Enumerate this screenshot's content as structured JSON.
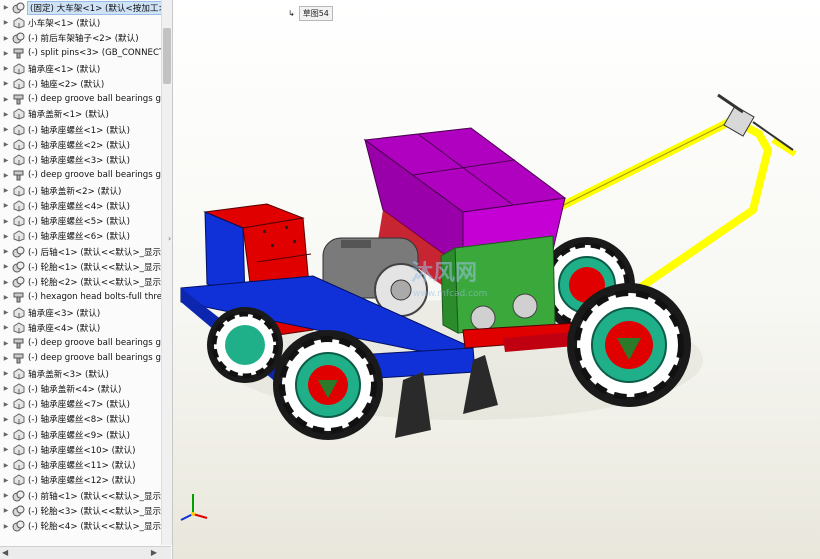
{
  "tree_items": [
    {
      "label": "(固定) 大车架<1> (默认<按加工>",
      "icon": "assembly-icon",
      "selected": true
    },
    {
      "label": "小车架<1> (默认)",
      "icon": "part-icon"
    },
    {
      "label": "(-) 前后车架轴子<2> (默认)",
      "icon": "assembly-icon"
    },
    {
      "label": "(-) split pins<3> (GB_CONNECT",
      "icon": "toolbox-part-icon"
    },
    {
      "label": "轴承座<1> (默认)",
      "icon": "part-icon"
    },
    {
      "label": "(-) 轴座<2> (默认)",
      "icon": "part-icon"
    },
    {
      "label": "(-) deep groove ball bearings g",
      "icon": "toolbox-part-icon"
    },
    {
      "label": "轴承盖新<1> (默认)",
      "icon": "part-icon"
    },
    {
      "label": "(-) 轴承座螺丝<1> (默认)",
      "icon": "part-icon"
    },
    {
      "label": "(-) 轴承座螺丝<2> (默认)",
      "icon": "part-icon"
    },
    {
      "label": "(-) 轴承座螺丝<3> (默认)",
      "icon": "part-icon"
    },
    {
      "label": "(-) deep groove ball bearings g",
      "icon": "toolbox-part-icon"
    },
    {
      "label": "(-) 轴承盖新<2> (默认)",
      "icon": "part-icon"
    },
    {
      "label": "(-) 轴承座螺丝<4> (默认)",
      "icon": "part-icon"
    },
    {
      "label": "(-) 轴承座螺丝<5> (默认)",
      "icon": "part-icon"
    },
    {
      "label": "(-) 轴承座螺丝<6> (默认)",
      "icon": "part-icon"
    },
    {
      "label": "(-) 后轴<1> (默认<<默认>_显示状",
      "icon": "assembly-icon"
    },
    {
      "label": "(-) 轮胎<1> (默认<<默认>_显示状",
      "icon": "assembly-icon"
    },
    {
      "label": "(-) 轮胎<2> (默认<<默认>_显示状",
      "icon": "assembly-icon"
    },
    {
      "label": "(-) hexagon head bolts-full thre",
      "icon": "toolbox-part-icon"
    },
    {
      "label": "轴承座<3> (默认)",
      "icon": "part-icon"
    },
    {
      "label": "轴承座<4> (默认)",
      "icon": "part-icon"
    },
    {
      "label": "(-) deep groove ball bearings g",
      "icon": "toolbox-part-icon"
    },
    {
      "label": "(-) deep groove ball bearings g",
      "icon": "toolbox-part-icon"
    },
    {
      "label": "轴承盖新<3> (默认)",
      "icon": "part-icon"
    },
    {
      "label": "(-) 轴承盖新<4> (默认)",
      "icon": "part-icon"
    },
    {
      "label": "(-) 轴承座螺丝<7> (默认)",
      "icon": "part-icon"
    },
    {
      "label": "(-) 轴承座螺丝<8> (默认)",
      "icon": "part-icon"
    },
    {
      "label": "(-) 轴承座螺丝<9> (默认)",
      "icon": "part-icon"
    },
    {
      "label": "(-) 轴承座螺丝<10> (默认)",
      "icon": "part-icon"
    },
    {
      "label": "(-) 轴承座螺丝<11> (默认)",
      "icon": "part-icon"
    },
    {
      "label": "(-) 轴承座螺丝<12> (默认)",
      "icon": "part-icon"
    },
    {
      "label": "(-) 前轴<1> (默认<<默认>_显示状",
      "icon": "assembly-icon"
    },
    {
      "label": "(-) 轮胎<3> (默认<<默认>_显示状",
      "icon": "assembly-icon"
    },
    {
      "label": "(-) 轮胎<4> (默认<<默认>_显示状",
      "icon": "assembly-icon"
    }
  ],
  "viewport": {
    "sketch_label": "草图54",
    "watermark_text": "沐风网",
    "watermark_url": "www.mfcad.com"
  },
  "colors": {
    "frame_blue": "#1030d8",
    "hopper_purple": "#b000c0",
    "box_green": "#3aa83a",
    "handle_yellow": "#ffff00",
    "crate_red": "#e00000",
    "wheel_green": "#1fb08a",
    "selection_blue": "#cfe3f7"
  }
}
